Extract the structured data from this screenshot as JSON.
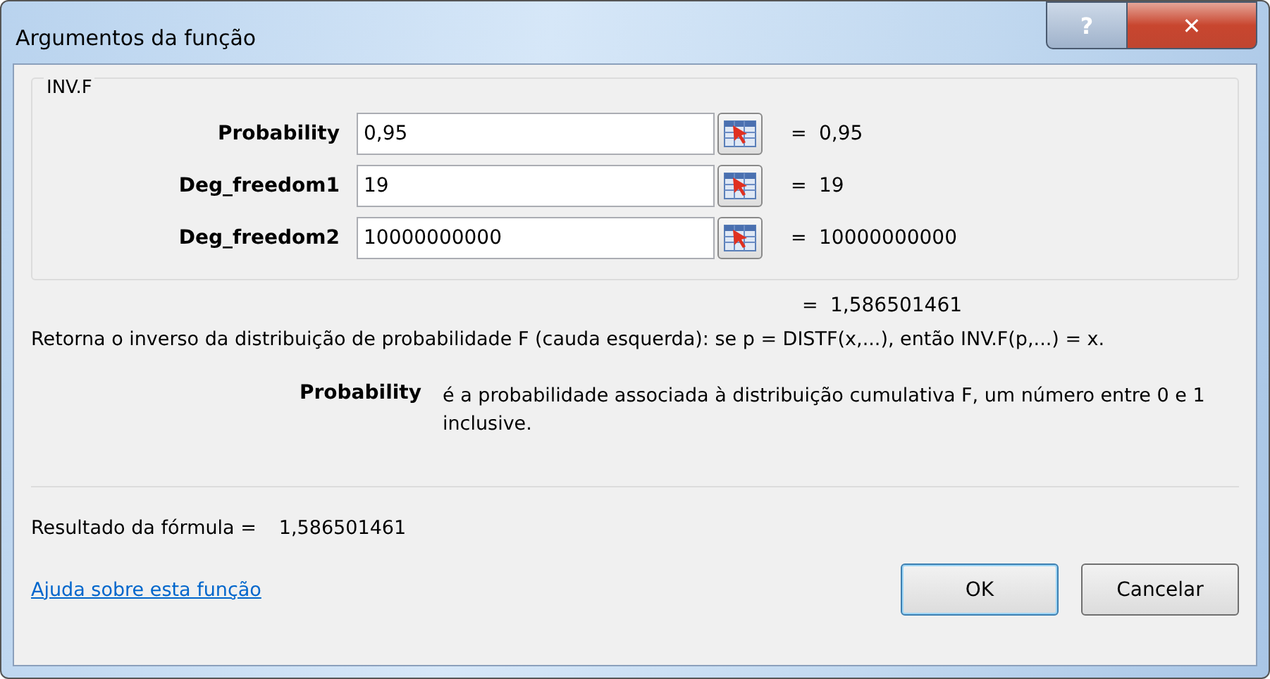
{
  "window": {
    "title": "Argumentos da função",
    "help_button": "?",
    "close_button": "✕"
  },
  "function_name": "INV.F",
  "arguments": [
    {
      "label": "Probability",
      "value": "0,95",
      "equals": "=",
      "evaluated": "0,95"
    },
    {
      "label": "Deg_freedom1",
      "value": "19",
      "equals": "=",
      "evaluated": "19"
    },
    {
      "label": "Deg_freedom2",
      "value": "10000000000",
      "equals": "=",
      "evaluated": "10000000000"
    }
  ],
  "result_preview": {
    "equals": "=",
    "value": "1,586501461"
  },
  "description": "Retorna o inverso da distribuição de probabilidade F (cauda esquerda): se p = DISTF(x,...), então INV.F(p,...) = x.",
  "argument_help": {
    "label": "Probability",
    "text": "é a probabilidade associada à distribuição cumulativa F, um número entre 0 e 1 inclusive."
  },
  "formula_result": {
    "label": "Resultado da fórmula =",
    "value": "1,586501461"
  },
  "help_link": "Ajuda sobre esta função",
  "buttons": [
    {
      "label": "OK",
      "default": true
    },
    {
      "label": "Cancelar",
      "default": false
    }
  ]
}
